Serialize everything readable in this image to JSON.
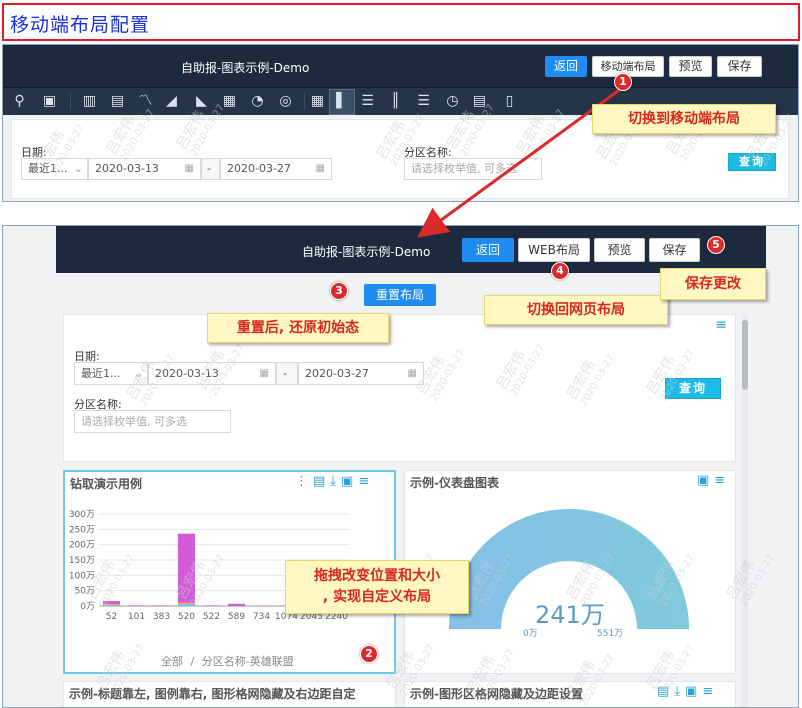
{
  "banner": {
    "title": "移动端布局配置"
  },
  "top_shot": {
    "app_title": "自助报-图表示例-Demo",
    "buttons": {
      "back": "返回",
      "mobile_layout": "移动端布局",
      "preview": "预览",
      "save": "保存"
    },
    "toolbar_icons": [
      "search-filter-icon",
      "text-icon",
      "bar-chart-icon",
      "stacked-bar-icon",
      "line-chart-icon",
      "area-chart-icon",
      "mountain-area-icon",
      "heatmap-icon",
      "pie-chart-icon",
      "donut-chart-icon",
      "table-icon",
      "column-chart-icon",
      "horizontal-bar-icon",
      "vertical-columns-icon",
      "list-icon",
      "gauge-icon",
      "report-icon",
      "document-icon"
    ],
    "filter": {
      "date_label": "日期:",
      "date_range_select": "最近1...",
      "date_start": "2020-03-13",
      "date_sep": "-",
      "date_end": "2020-03-27",
      "partition_label": "分区名称:",
      "partition_placeholder": "请选择枚举值, 可多选",
      "query_button": "查询"
    }
  },
  "bottom_shot": {
    "app_title": "自助报-图表示例-Demo",
    "buttons": {
      "back": "返回",
      "web_layout": "WEB布局",
      "preview": "预览",
      "save": "保存"
    },
    "reset_button": "重置布局",
    "filter": {
      "date_label": "日期:",
      "date_range_select": "最近1...",
      "date_start": "2020-03-13",
      "date_sep": "-",
      "date_end": "2020-03-27",
      "partition_label": "分区名称:",
      "partition_placeholder": "请选择枚举值, 可多选",
      "query_button": "查询"
    },
    "cards": {
      "drill": {
        "title": "钻取演示用例",
        "breadcrumb_all": "全部",
        "breadcrumb_sep": "/",
        "breadcrumb_item": "分区名称-英雄联盟"
      },
      "gauge": {
        "title": "示例-仪表盘图表",
        "value": "241万",
        "min": "0万",
        "max": "551万"
      },
      "card3": {
        "title": "示例-标题靠左, 图例靠右, 图形格网隐藏及右边距自定"
      },
      "card4": {
        "title": "示例-图形区格网隐藏及边距设置"
      }
    }
  },
  "chart_data": {
    "type": "bar",
    "categories": [
      "52",
      "101",
      "383",
      "520",
      "522",
      "589",
      "734",
      "1074",
      "2045",
      "2240"
    ],
    "y_tick_labels": [
      "0万",
      "50万",
      "100万",
      "150万",
      "200万",
      "250万",
      "300万"
    ],
    "ylim": [
      0,
      300
    ],
    "series": [
      {
        "values": [
          10,
          2,
          2,
          225,
          2,
          7,
          1,
          1,
          1,
          1
        ],
        "color": "#d35ad8"
      },
      {
        "values": [
          3,
          0,
          0,
          5,
          0,
          0,
          0,
          0,
          0,
          0
        ],
        "color": "#f0a85a"
      },
      {
        "values": [
          3,
          0,
          0,
          6,
          0,
          0,
          0,
          0,
          0,
          0
        ],
        "color": "#6cc0e8"
      }
    ],
    "x_tick_labels_visible": [
      "52",
      "101",
      "383",
      "520",
      "522",
      "589",
      "734",
      "1074",
      "2045",
      "2240"
    ]
  },
  "callouts": {
    "c1": "切换到移动端布局",
    "c2": "重置后, 还原初始态",
    "c3": "切换回网页布局",
    "c4": "保存更改",
    "c5a": "拖拽改变位置和大小",
    "c5b": ", 实现自定义布局"
  },
  "numbers": [
    "1",
    "2",
    "3",
    "4",
    "5"
  ],
  "watermark": {
    "name": "吕宏伟",
    "date": "2020-03-27"
  }
}
